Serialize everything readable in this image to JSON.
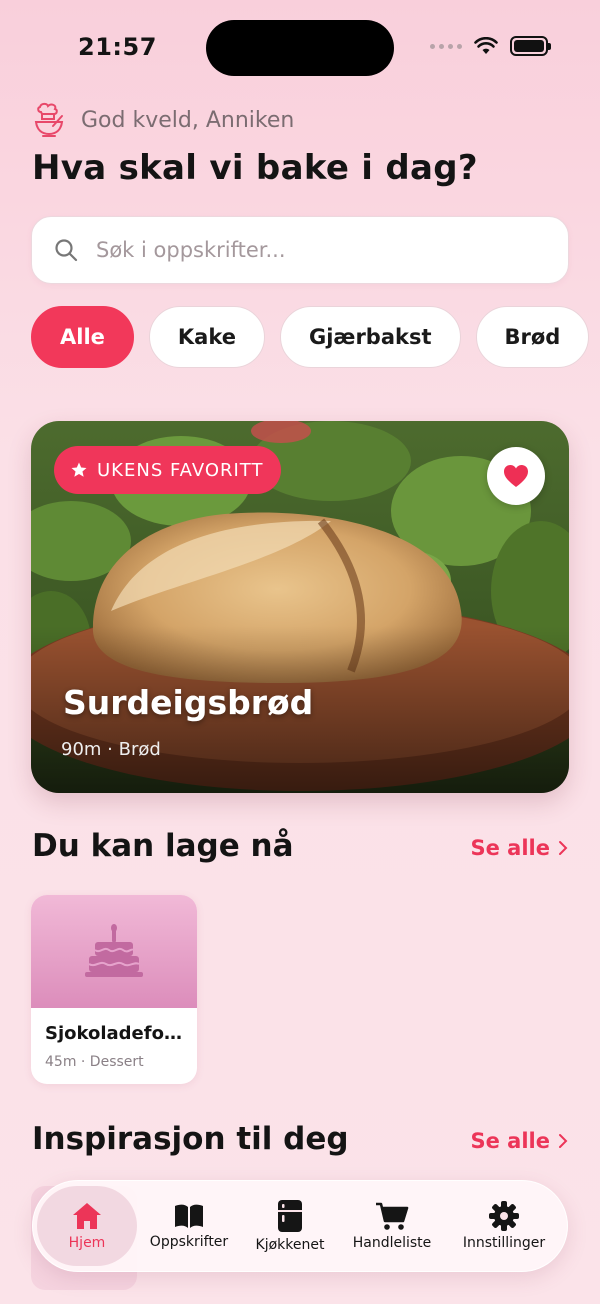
{
  "status_bar": {
    "time": "21:57"
  },
  "header": {
    "greeting": "God kveld, Anniken",
    "headline": "Hva skal vi bake i dag?"
  },
  "search": {
    "placeholder": "Søk i oppskrifter..."
  },
  "categories": [
    "Alle",
    "Kake",
    "Gjærbakst",
    "Brød"
  ],
  "featured": {
    "badge": "UKENS FAVORITT",
    "title": "Surdeigsbrød",
    "meta": "90m · Brød"
  },
  "can_make_now": {
    "title": "Du kan lage nå",
    "see_all": "Se alle",
    "recipes": [
      {
        "name": "Sjokoladefo…",
        "meta": "45m · Dessert"
      }
    ]
  },
  "inspiration": {
    "title": "Inspirasjon til deg",
    "see_all": "Se alle"
  },
  "nav": {
    "items": [
      {
        "label": "Hjem",
        "icon": "home-icon"
      },
      {
        "label": "Oppskrifter",
        "icon": "book-icon"
      },
      {
        "label": "Kjøkkenet",
        "icon": "fridge-icon"
      },
      {
        "label": "Handleliste",
        "icon": "cart-icon"
      },
      {
        "label": "Innstillinger",
        "icon": "gear-icon"
      }
    ]
  },
  "colors": {
    "accent": "#F2385A",
    "background": "#FBE0E7"
  }
}
